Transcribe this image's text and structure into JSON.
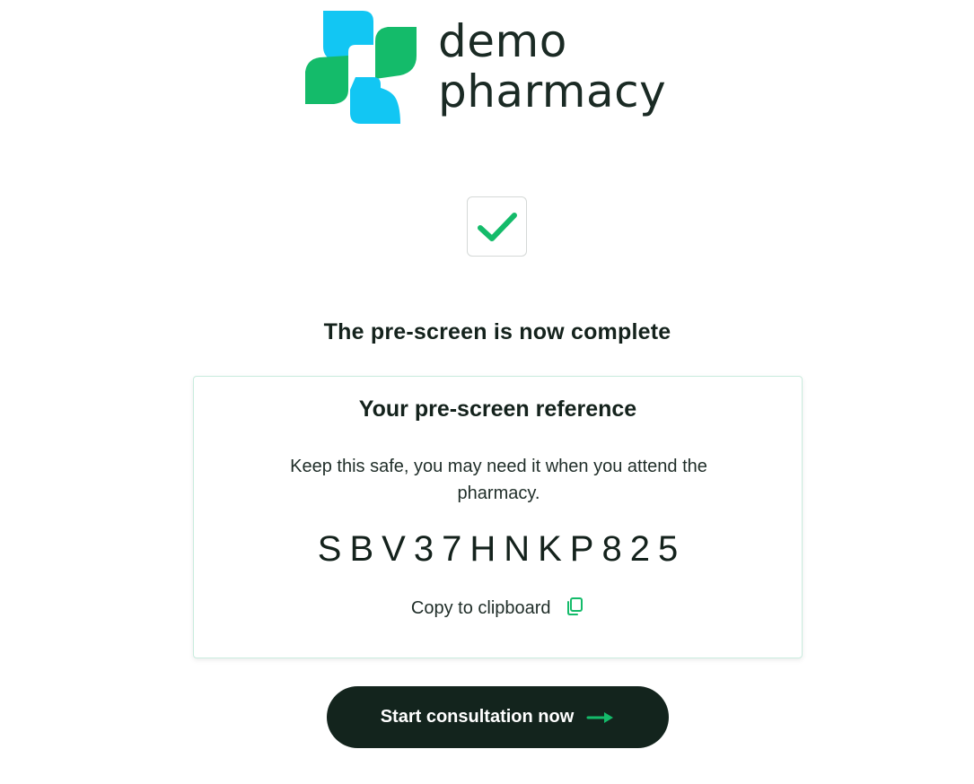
{
  "brand": {
    "name_line1": "demo",
    "name_line2": "pharmacy",
    "colors": {
      "blue": "#12c6f3",
      "green": "#14bb6a",
      "dark": "#13241d"
    }
  },
  "status": {
    "icon": "checkmark-icon",
    "title": "The pre-screen is now complete"
  },
  "reference_card": {
    "title": "Your pre-screen reference",
    "description": "Keep this safe, you may need it when you attend the pharmacy.",
    "code": "SBV37HNKP825",
    "copy_label": "Copy to clipboard",
    "copy_icon": "copy-icon"
  },
  "actions": {
    "start_label": "Start consultation now",
    "start_icon": "arrow-right-icon"
  }
}
